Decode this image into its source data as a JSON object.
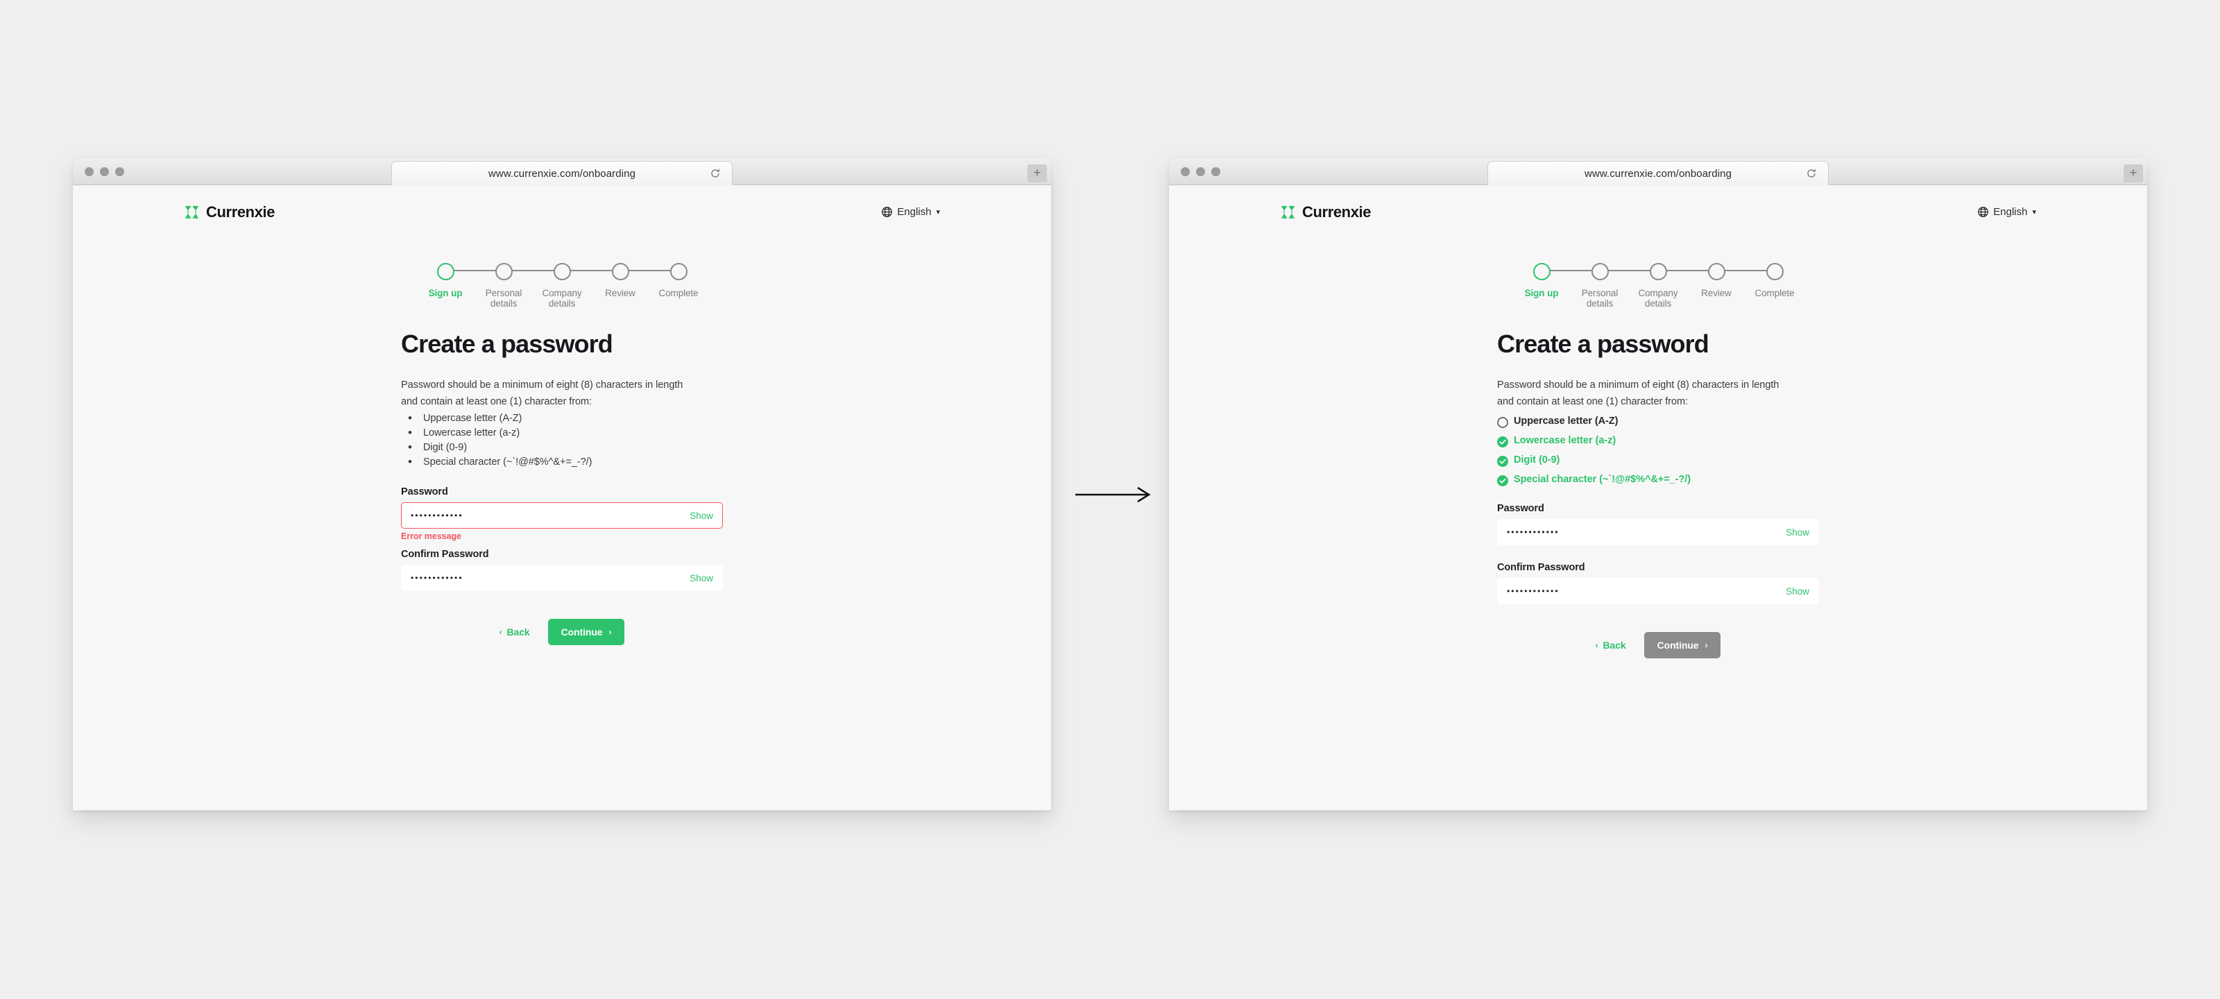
{
  "canvas": {
    "background_color": "#efefef",
    "arrow_icon": "right-arrow-icon"
  },
  "theme": {
    "brand_green": "#2ec26c",
    "error_red": "#f4555f",
    "disabled_grey": "#8b8b8b",
    "page_background": "#f7f7f7"
  },
  "browser": {
    "url": "www.currenxie.com/onboarding",
    "reload_icon": "reload-icon",
    "new_tab_label": "+",
    "traffic_lights": [
      "close",
      "minimize",
      "maximize"
    ]
  },
  "header": {
    "brand_name": "Currenxie",
    "brand_mark_icon": "currenxie-logo-icon",
    "language": "English",
    "globe_icon": "globe-icon",
    "caret_icon": "chevron-down-icon"
  },
  "stepper": {
    "steps": [
      {
        "label": "Sign up",
        "state": "active"
      },
      {
        "label": "Personal details",
        "state": "inactive"
      },
      {
        "label": "Company details",
        "state": "inactive"
      },
      {
        "label": "Review",
        "state": "inactive"
      },
      {
        "label": "Complete",
        "state": "inactive"
      }
    ]
  },
  "form": {
    "title": "Create a password",
    "intro_line_1": "Password should be a minimum of eight (8) characters in length",
    "intro_line_2": "and contain at least one (1) character from:",
    "requirements": [
      "Uppercase letter (A-Z)",
      "Lowercase letter (a-z)",
      "Digit (0-9)",
      "Special character (~`!@#$%^&+=_-?/)"
    ],
    "password_label": "Password",
    "password_value": "••••••••••••",
    "confirm_label": "Confirm Password",
    "confirm_value": "••••••••••••",
    "show_label": "Show",
    "error_message": "Error message",
    "back_label": "Back",
    "continue_label": "Continue",
    "back_chevron": "‹",
    "continue_chevron": "›"
  },
  "state_left": {
    "variant": "error-state",
    "password_field_error": true,
    "error_visible": true,
    "continue_enabled": true,
    "requirements_style": "bulleted"
  },
  "state_right": {
    "variant": "validation-state",
    "password_field_error": false,
    "error_visible": false,
    "continue_enabled": false,
    "requirements_style": "checked",
    "requirement_states": [
      "pending",
      "met",
      "met",
      "met"
    ]
  }
}
